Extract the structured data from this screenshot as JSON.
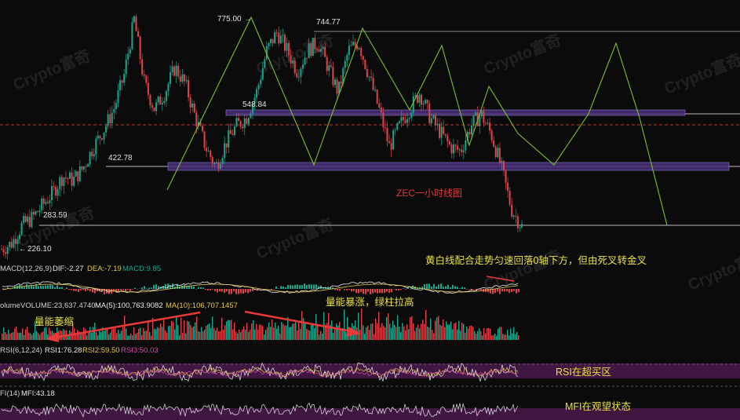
{
  "watermark": "Crypto富奇",
  "chart_data": {
    "type": "candlestick",
    "title": "ZEC一小时线图",
    "price_levels": [
      {
        "label": "775.00",
        "value": 775.0
      },
      {
        "label": "744.77",
        "value": 744.77
      },
      {
        "label": "548.84",
        "value": 548.84
      },
      {
        "label": "422.78",
        "value": 422.78
      },
      {
        "label": "283.59",
        "value": 283.59
      },
      {
        "label": "226.10",
        "value": 226.1
      }
    ],
    "zones": [
      {
        "name": "upper-zone",
        "from": 540,
        "to": 552
      },
      {
        "name": "lower-zone",
        "from": 412,
        "to": 425
      }
    ],
    "price_path_y": [
      226,
      240,
      283,
      300,
      330,
      360,
      400,
      390,
      420,
      470,
      510,
      560,
      640,
      775,
      620,
      560,
      600,
      660,
      620,
      540,
      470,
      422,
      480,
      520,
      540,
      600,
      700,
      744,
      700,
      650,
      700,
      720,
      660,
      600,
      700,
      720,
      640,
      560,
      470,
      520,
      560,
      600,
      540,
      505,
      470,
      460,
      520,
      548,
      500,
      420,
      320,
      280
    ],
    "indicators": {
      "macd": {
        "label": "MACD(12,26,9)",
        "dif_label": "DIF:-2.27",
        "dea_label": "DEA:-7.19",
        "macd_label": "MACD:9.85"
      },
      "volume": {
        "label": "olume",
        "volume_label": "VOLUME:23,637.4740",
        "ma5_label": "MA(5):100,763.9082",
        "ma10_label": "MA(10):106,707.1457"
      },
      "rsi": {
        "label": "RSI(6,12,24)",
        "rsi1_label": "RSI1:76.28",
        "rsi2_label": "RSI2:59.50",
        "rsi3_label": "RSI3:50.03"
      },
      "mfi": {
        "label": "FI(14)",
        "value_label": "MFI:43.18"
      }
    },
    "annotations": {
      "macd_note": "黄白线配合走势匀速回落0轴下方，但由死叉转金叉",
      "volume_surge": "量能暴涨，绿柱拉高",
      "volume_shrink": "量能萎缩",
      "rsi_note": "RSI在超买区",
      "mfi_note": "MFI在观望状态"
    },
    "colors": {
      "up": "#1aa68c",
      "down": "#e0444a",
      "projection": "#7fbf2a",
      "zone": "#5a3a8a",
      "dif": "#e8e8e8",
      "dea": "#e8c84a",
      "annotation": "#e8e04a",
      "arrow": "#e83a3a",
      "rsi_band": "#4a1a4a"
    }
  }
}
